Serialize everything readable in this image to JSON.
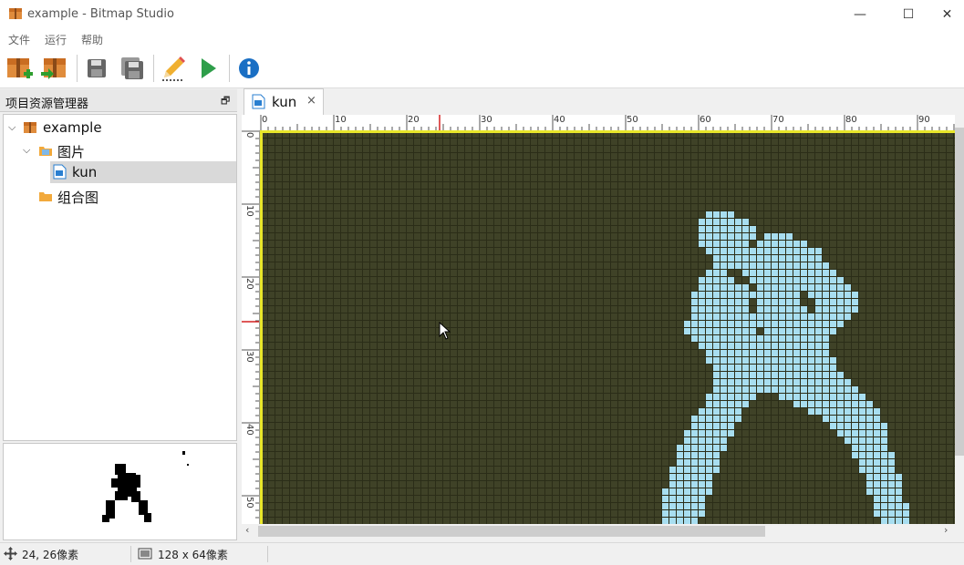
{
  "window": {
    "title": "example - Bitmap Studio",
    "minimize": "—",
    "maximize": "☐",
    "close": "✕"
  },
  "menu": [
    {
      "label": "文件"
    },
    {
      "label": "运行"
    },
    {
      "label": "帮助"
    }
  ],
  "toolbar": {
    "buttons": [
      "new-project-icon",
      "open-project-icon",
      "save-icon",
      "save-all-icon",
      "edit-icon",
      "run-icon",
      "info-icon"
    ]
  },
  "project_panel": {
    "title": "项目资源管理器",
    "float_icon": "🗗",
    "tree": [
      {
        "label": "example",
        "level": 0,
        "expanded": true
      },
      {
        "label": "图片",
        "level": 1,
        "expanded": true
      },
      {
        "label": "kun",
        "level": 2,
        "selected": true
      },
      {
        "label": "组合图",
        "level": 1
      }
    ]
  },
  "editor": {
    "tab": {
      "label": "kun",
      "close": "×"
    },
    "ruler_top_labels": [
      "0",
      "10",
      "20",
      "30",
      "40",
      "50",
      "60",
      "70",
      "80",
      "90"
    ],
    "ruler_left_labels": [
      "0",
      "10",
      "20",
      "30",
      "40",
      "50"
    ],
    "canvas": {
      "bg_color": "#3f4227",
      "grid_color": "#2b2d18",
      "pixel_color": "#a8def0",
      "border_color": "#e8e62a"
    }
  },
  "status": {
    "cursor_pos": "24, 26像素",
    "image_size": "128 x 64像素"
  },
  "colors": {
    "accent_red": "#d42020",
    "selection": "#d9d9d9"
  }
}
